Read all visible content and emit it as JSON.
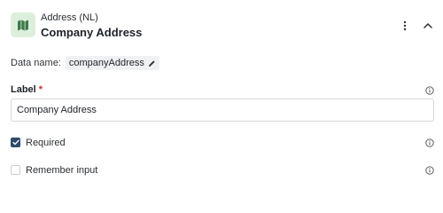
{
  "header": {
    "field_type": "Address (NL)",
    "field_title": "Company Address"
  },
  "data_name": {
    "label": "Data name:",
    "value": "companyAddress"
  },
  "label_field": {
    "label": "Label",
    "required_marker": "*",
    "value": "Company Address"
  },
  "options": [
    {
      "label": "Required",
      "checked": true
    },
    {
      "label": "Remember input",
      "checked": false
    }
  ],
  "colors": {
    "accent": "#2f4a6b",
    "icon_bg": "#dcefdc",
    "icon_fg": "#3f7a4a",
    "required": "#c4302b"
  },
  "icons": {
    "app": "map-icon",
    "menu": "more-vertical-icon",
    "collapse": "chevron-up-icon",
    "edit": "pencil-icon",
    "info": "info-icon",
    "check": "check-icon"
  }
}
